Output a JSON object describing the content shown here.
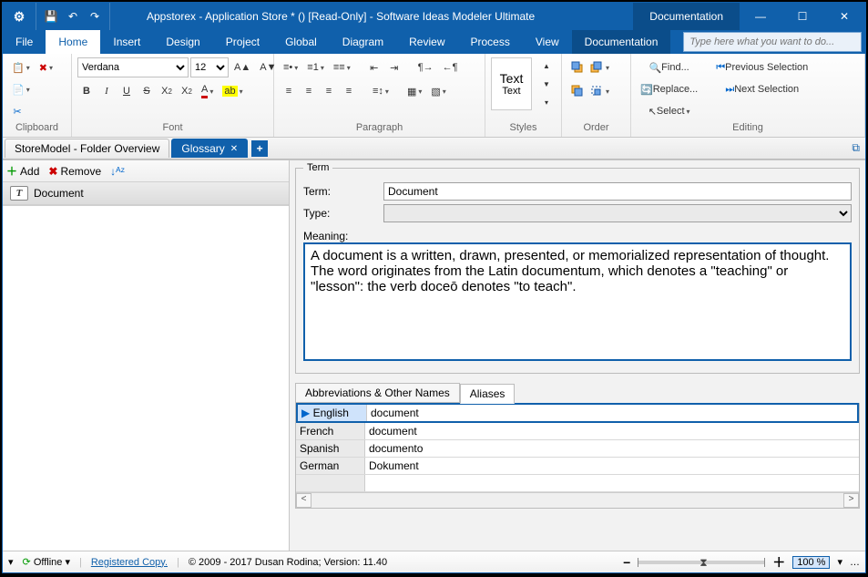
{
  "title": "Appstorex - Application Store * () [Read-Only] - Software Ideas Modeler Ultimate",
  "titlebar_doc": "Documentation",
  "menu": {
    "file": "File",
    "home": "Home",
    "insert": "Insert",
    "design": "Design",
    "project": "Project",
    "global": "Global",
    "diagram": "Diagram",
    "review": "Review",
    "process": "Process",
    "view": "View",
    "doc": "Documentation",
    "search_placeholder": "Type here what you want to do..."
  },
  "ribbon": {
    "clipboard": "Clipboard",
    "font": "Font",
    "font_name": "Verdana",
    "font_size": "12",
    "paragraph": "Paragraph",
    "styles": "Styles",
    "text_big": "Text",
    "text_big_label": "Text",
    "order": "Order",
    "editing": "Editing",
    "find": "Find...",
    "replace": "Replace...",
    "select": "Select",
    "prev_sel": "Previous Selection",
    "next_sel": "Next Selection"
  },
  "tabs": {
    "t1": "StoreModel - Folder Overview",
    "t2": "Glossary"
  },
  "left": {
    "add": "Add",
    "remove": "Remove",
    "item": "Document"
  },
  "term": {
    "legend": "Term",
    "term_label": "Term:",
    "term_value": "Document",
    "type_label": "Type:",
    "type_value": "",
    "meaning_label": "Meaning:",
    "meaning_value": "A document is a written, drawn, presented, or memorialized representation of thought. The word originates from the Latin documentum, which denotes a \"teaching\" or \"lesson\": the verb doceō denotes \"to teach\"."
  },
  "subtabs": {
    "abbr": "Abbreviations & Other Names",
    "aliases": "Aliases"
  },
  "aliases": [
    {
      "lang": "English",
      "val": "document"
    },
    {
      "lang": "French",
      "val": "document"
    },
    {
      "lang": "Spanish",
      "val": "documento"
    },
    {
      "lang": "German",
      "val": "Dokument"
    }
  ],
  "status": {
    "offline": "Offline",
    "registered": "Registered Copy.",
    "copyright": "© 2009 - 2017 Dusan Rodina; Version: 11.40",
    "zoom": "100 %"
  }
}
